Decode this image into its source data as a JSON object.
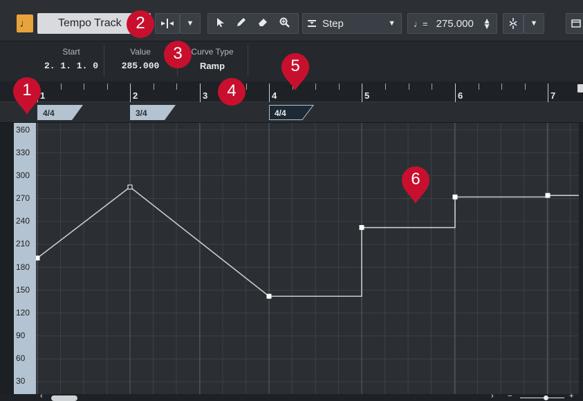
{
  "toolbar": {
    "tempo_toggle_icon": "tempo-track-icon",
    "track_name": "Tempo Track",
    "insert_mode_icon": "insert-mode-icon",
    "step_label": "Step",
    "tempo_value": "275.000",
    "tempo_symbol": "♩=",
    "accent": "#e8a33a"
  },
  "infoline": {
    "start_label": "Start",
    "start_value": "2. 1. 1. 0",
    "value_label": "Value",
    "value_value": "285.000",
    "curve_label": "Curve Type",
    "curve_value": "Ramp"
  },
  "ruler": {
    "bars": [
      "1",
      "2",
      "3",
      "4",
      "5",
      "6",
      "7"
    ]
  },
  "signatures": [
    {
      "label": "4/4",
      "selected": false
    },
    {
      "label": "3/4",
      "selected": false
    },
    {
      "label": "4/4",
      "selected": true
    }
  ],
  "scale": {
    "labels": [
      "360",
      "330",
      "300",
      "270",
      "240",
      "210",
      "180",
      "150",
      "120",
      "90",
      "60",
      "30"
    ]
  },
  "tempo_curve": {
    "points": [
      {
        "position": "1",
        "bpm": 192,
        "type": "ramp"
      },
      {
        "position": "2",
        "bpm": 285,
        "type": "ramp"
      },
      {
        "position": "4",
        "bpm": 142,
        "type": "jump"
      },
      {
        "position": "5",
        "bpm": 232,
        "type": "jump"
      },
      {
        "position": "6",
        "bpm": 272,
        "type": "jump"
      },
      {
        "position": "7",
        "bpm": 274,
        "type": "jump"
      }
    ]
  },
  "callouts": [
    "1",
    "2",
    "3",
    "4",
    "5",
    "6"
  ],
  "colors": {
    "callout": "#c8102e",
    "scale_bg": "#b4c3d1",
    "curve": "#c9cdd1"
  }
}
